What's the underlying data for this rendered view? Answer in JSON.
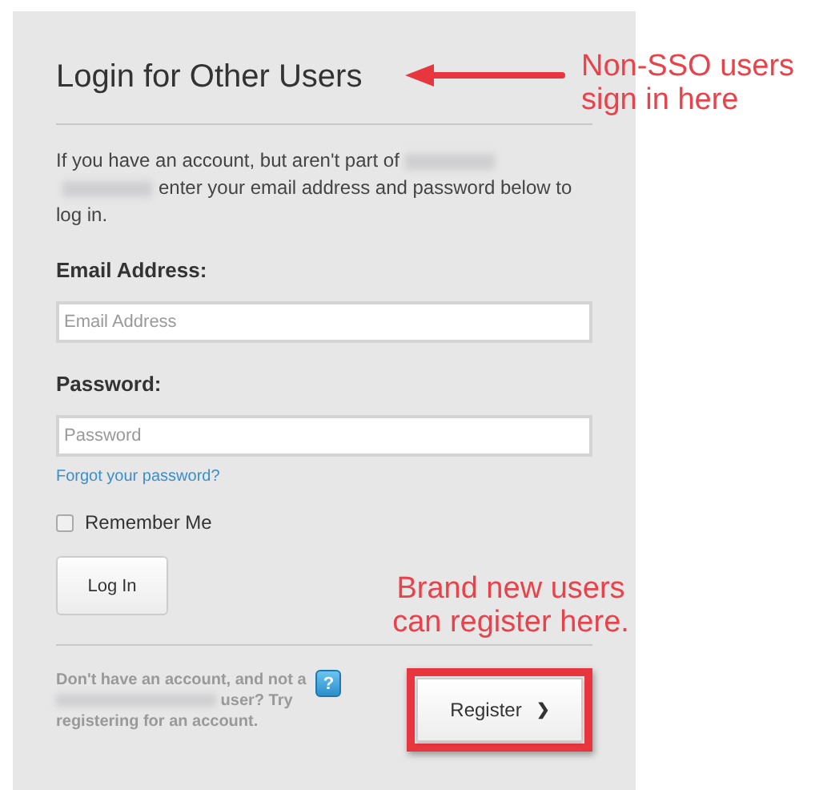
{
  "title": "Login for Other Users",
  "intro": {
    "before": "If you have an account, but aren't part of",
    "after": "enter your email address and password below to log in."
  },
  "fields": [
    {
      "label": "Email Address:",
      "placeholder": "Email Address"
    },
    {
      "label": "Password:",
      "placeholder": "Password"
    }
  ],
  "forgot_link": "Forgot your password?",
  "remember_me": {
    "label": "Remember Me",
    "checked": false
  },
  "login_button": "Log In",
  "register_note": {
    "before": "Don't have an account, and not a",
    "after": "user? Try registering for an account."
  },
  "help_badge": "?",
  "register_button": {
    "label": "Register",
    "caret": "❯"
  },
  "annotations": [
    {
      "text": "Non-SSO users sign in here",
      "kind": "arrow"
    },
    {
      "text": "Brand new users can register here.",
      "kind": "highlight"
    }
  ]
}
